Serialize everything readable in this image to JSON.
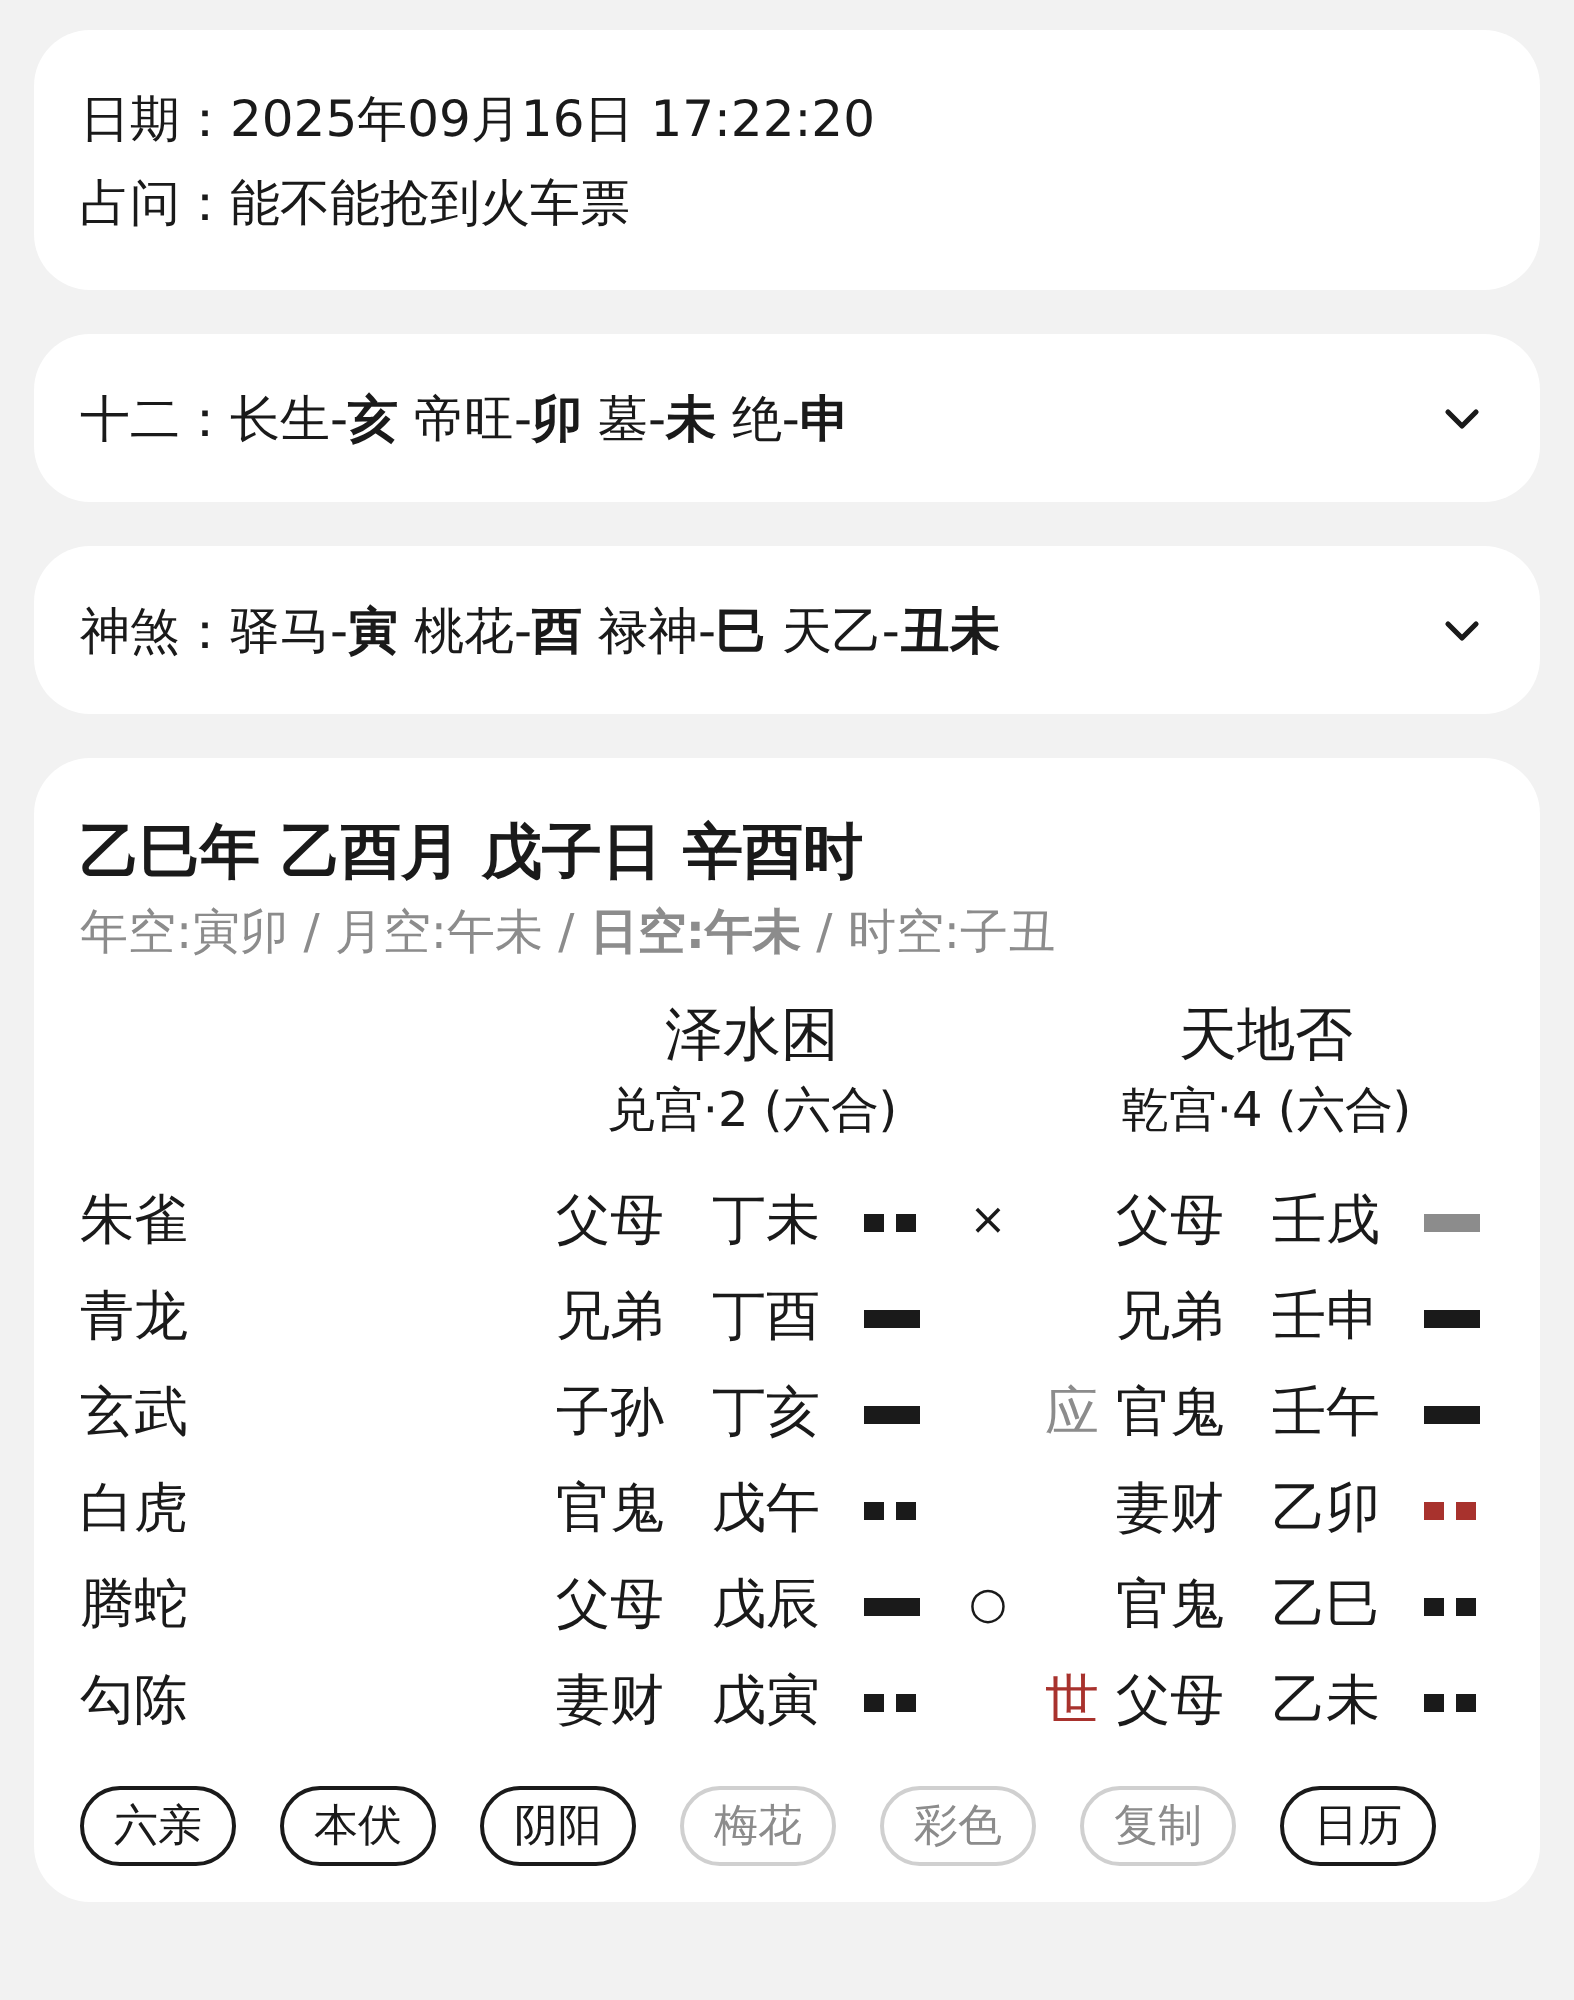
{
  "info": {
    "rows": [
      {
        "label": "日期：",
        "value": "2025年09月16日 17:22:20"
      },
      {
        "label": "占问：",
        "value": "能不能抢到火车票"
      }
    ]
  },
  "panels": [
    {
      "label": "十二：",
      "text": "长生-**亥** 帝旺-**卯** 墓-**未** 绝-**申**",
      "expanded": false
    },
    {
      "label": "神煞：",
      "text": "驿马-**寅** 桃花-**酉** 禄神-**巳** 天乙-**丑未**",
      "expanded": false
    }
  ],
  "chart": {
    "title": "乙巳年 乙酉月 戊子日 辛酉时",
    "voids": "年空:寅卯 / 月空:午未 / **日空:午未** / 时空:子丑",
    "hexagrams": [
      {
        "name": "泽水困",
        "palace": "兑宫·2 (六合)"
      },
      {
        "name": "天地否",
        "palace": "乾宫·4 (六合)"
      }
    ],
    "rows": [
      {
        "god": "朱雀",
        "left": {
          "relation": "父母",
          "branch": "丁未",
          "kind": "yin",
          "color": "#1a1a1a",
          "mark": "×"
        },
        "position": null,
        "right": {
          "relation": "父母",
          "branch": "壬戌",
          "kind": "yang",
          "color": "#8c8c8c"
        }
      },
      {
        "god": "青龙",
        "left": {
          "relation": "兄弟",
          "branch": "丁酉",
          "kind": "yang",
          "color": "#1a1a1a"
        },
        "position": null,
        "right": {
          "relation": "兄弟",
          "branch": "壬申",
          "kind": "yang",
          "color": "#1a1a1a"
        }
      },
      {
        "god": "玄武",
        "left": {
          "relation": "子孙",
          "branch": "丁亥",
          "kind": "yang",
          "color": "#1a1a1a"
        },
        "position": {
          "kind": "ying",
          "text": "应"
        },
        "right": {
          "relation": "官鬼",
          "branch": "壬午",
          "kind": "yang",
          "color": "#1a1a1a"
        }
      },
      {
        "god": "白虎",
        "left": {
          "relation": "官鬼",
          "branch": "戊午",
          "kind": "yin",
          "color": "#1a1a1a"
        },
        "position": null,
        "right": {
          "relation": "妻财",
          "branch": "乙卯",
          "kind": "yin",
          "color": "#a8322d"
        }
      },
      {
        "god": "腾蛇",
        "left": {
          "relation": "父母",
          "branch": "戊辰",
          "kind": "yang",
          "color": "#1a1a1a",
          "mark": "○"
        },
        "position": null,
        "right": {
          "relation": "官鬼",
          "branch": "乙巳",
          "kind": "yin",
          "color": "#1a1a1a"
        }
      },
      {
        "god": "勾陈",
        "left": {
          "relation": "妻财",
          "branch": "戊寅",
          "kind": "yin",
          "color": "#1a1a1a"
        },
        "position": {
          "kind": "shi",
          "text": "世"
        },
        "right": {
          "relation": "父母",
          "branch": "乙未",
          "kind": "yin",
          "color": "#1a1a1a"
        }
      }
    ],
    "chips": [
      {
        "label": "六亲",
        "on": true
      },
      {
        "label": "本伏",
        "on": true
      },
      {
        "label": "阴阳",
        "on": true
      },
      {
        "label": "梅花",
        "on": false
      },
      {
        "label": "彩色",
        "on": false
      },
      {
        "label": "复制",
        "on": false
      },
      {
        "label": "日历",
        "on": true
      }
    ]
  }
}
